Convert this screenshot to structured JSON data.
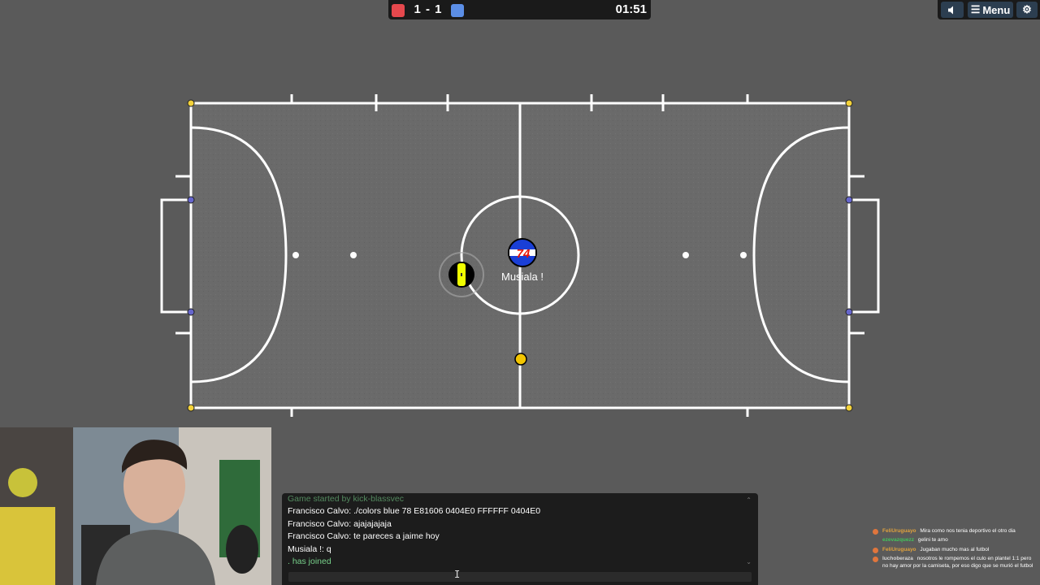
{
  "scoreboard": {
    "red_color": "#e5484d",
    "blue_color": "#5b8ee6",
    "score": "1 - 1",
    "time": "01:51"
  },
  "top_controls": {
    "sound_icon": "speaker-icon",
    "menu_label": "Menu",
    "settings_icon": "gear-icon"
  },
  "field": {
    "players": [
      {
        "team": "blue",
        "number": "74",
        "name": "Musiala !",
        "color": "#1a3fd6"
      },
      {
        "team": "red",
        "number": "",
        "name": "",
        "color": "#f0ff00"
      }
    ],
    "ball_color": "#f3c500"
  },
  "chat": {
    "messages": [
      {
        "text": "Game started by kick-blassvec",
        "system": true
      },
      {
        "text": "Francisco Calvo: ./colors blue 78 E81606 0404E0 FFFFFF 0404E0",
        "system": false
      },
      {
        "text": "Francisco Calvo: ajajajajaja",
        "system": false
      },
      {
        "text": "Francisco Calvo: te pareces a jaime hoy",
        "system": false
      },
      {
        "text": "Musiala !: q",
        "system": false
      },
      {
        "text": ". has joined",
        "system": true
      }
    ],
    "input_value": ""
  },
  "stream_chat": [
    {
      "user": "FeliUruguayo",
      "user_color": "#e0a23d",
      "text": "Mira como nos tenia deportivo el otro dia"
    },
    {
      "user": "ezevazquezz",
      "user_color": "#43c35c",
      "text": "gelini te amo"
    },
    {
      "user": "FeliUruguayo",
      "user_color": "#e0a23d",
      "text": "Jugaban mucho mas al futbol"
    },
    {
      "user": "luchoberaza",
      "user_color": "#d8d8d8",
      "text": "nosotros le rompemos el culo en plantel 1:1 pero no hay amor por la camiseta, por eso digo que se murió el futbol"
    }
  ]
}
